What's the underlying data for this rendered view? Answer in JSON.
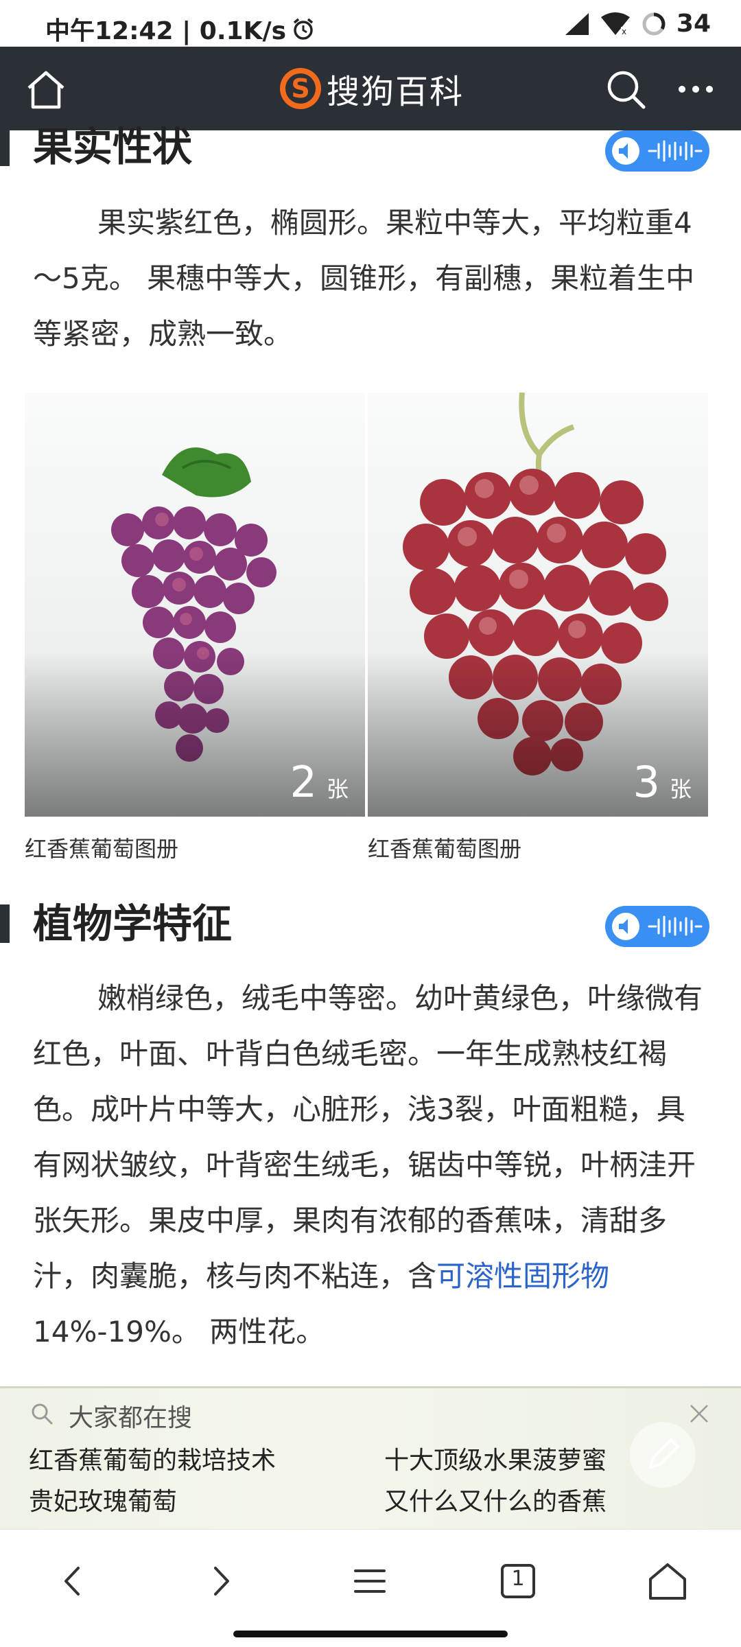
{
  "status_bar": {
    "time_speed": "中午12:42 | 0.1K/s",
    "battery": "34"
  },
  "app_bar": {
    "brand_name": "搜狗百科",
    "brand_color": "#f26b1d",
    "bar_color": "#2b2f36"
  },
  "section1": {
    "title": "果实性状",
    "paragraph": "果实紫红色，椭圆形。果粒中等大，平均粒重4～5克。 果穗中等大，圆锥形，有副穗，果粒着生中等紧密，成熟一致。"
  },
  "gallery": [
    {
      "count": "2",
      "unit": "张",
      "caption": "红香蕉葡萄图册"
    },
    {
      "count": "3",
      "unit": "张",
      "caption": "红香蕉葡萄图册"
    }
  ],
  "section2": {
    "title": "植物学特征",
    "paragraph_before_link": "嫩梢绿色，绒毛中等密。幼叶黄绿色，叶缘微有红色，叶面、叶背白色绒毛密。一年生成熟枝红褐色。成叶片中等大，心脏形，浅3裂，叶面粗糙，具有网状皱纹，叶背密生绒毛，锯齿中等锐，叶柄洼开张矢形。果皮中厚，果肉有浓郁的香蕉味，清甜多汁，肉囊脆，核与肉不粘连，含",
    "link_text": "可溶性固形物",
    "paragraph_after_link": "14%-19%。 两性花。"
  },
  "suggestions": {
    "title": "大家都在搜",
    "items": [
      "红香蕉葡萄的栽培技术",
      "十大顶级水果菠萝蜜",
      "贵妃玫瑰葡萄",
      "又什么又什么的香蕉"
    ]
  },
  "bottom_nav": {
    "tab_count": "1"
  },
  "colors": {
    "accent_blue": "#3a8ff2",
    "link_blue": "#2a63c9"
  }
}
